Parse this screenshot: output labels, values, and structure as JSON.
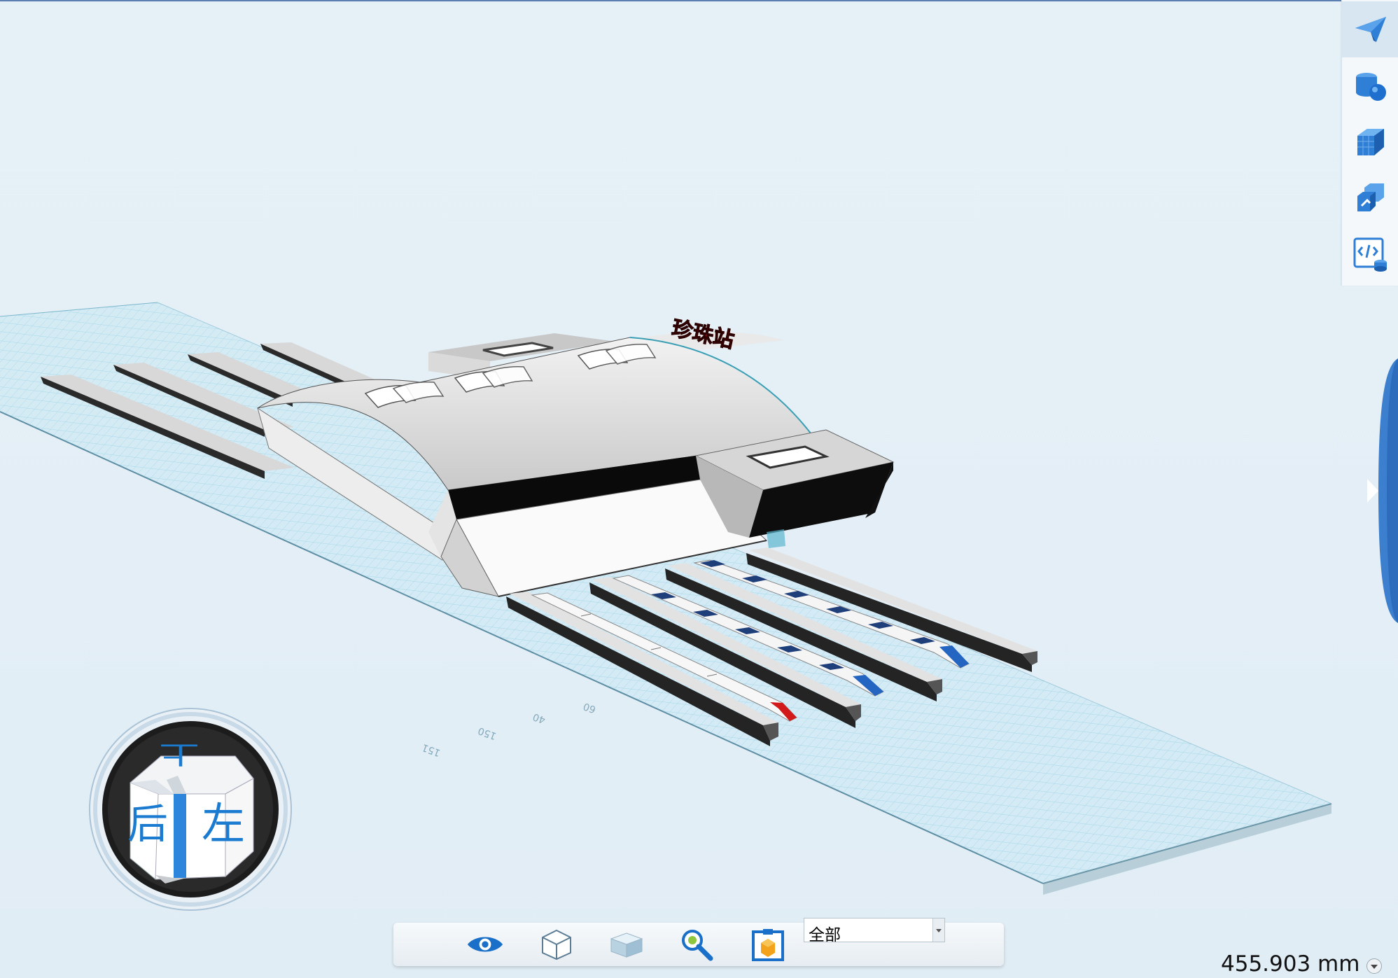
{
  "viewport": {
    "sign_text": "珍珠站",
    "grid_labels": [
      "151",
      "150",
      "40",
      "60"
    ]
  },
  "nav_cube": {
    "face_front": "后",
    "face_right": "左",
    "face_top": "上"
  },
  "right_toolbar": {
    "items": [
      {
        "icon": "paper-plane-icon",
        "active": true
      },
      {
        "icon": "database-sphere-icon"
      },
      {
        "icon": "solid-cube-icon"
      },
      {
        "icon": "linked-cubes-icon"
      },
      {
        "icon": "code-document-icon"
      }
    ],
    "expand_icon": "chevron-right-icon"
  },
  "bottom_toolbar": {
    "items": [
      {
        "icon": "eye-icon"
      },
      {
        "icon": "wireframe-cube-icon"
      },
      {
        "icon": "shaded-cube-icon"
      },
      {
        "icon": "zoom-icon"
      },
      {
        "icon": "section-box-icon"
      }
    ],
    "filter_select": {
      "value": "全部"
    }
  },
  "status": {
    "measure": "455.903 mm"
  },
  "colors": {
    "accent": "#1a7bd0",
    "panel_blue": "#3d7fd0",
    "grid": "#8ccfe6",
    "background": "#e3eef6"
  }
}
